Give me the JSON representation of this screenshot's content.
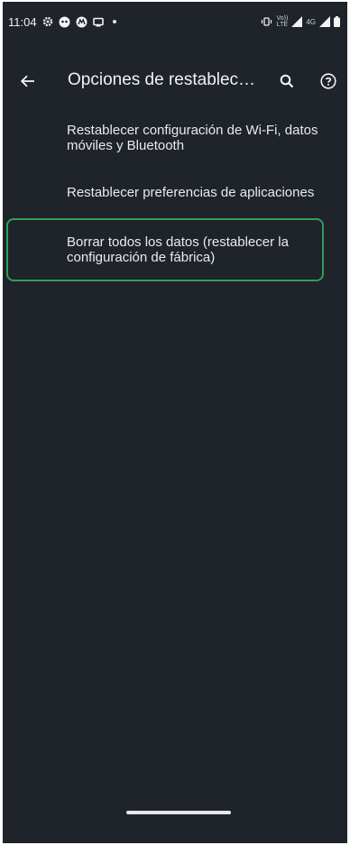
{
  "status_bar": {
    "time": "11:04",
    "left_icons": [
      "gear-icon",
      "face-icon",
      "motorola-icon",
      "screen-cast-icon",
      "notification-dot-icon"
    ],
    "right_icons": [
      "vibrate-icon",
      "volte-icon",
      "signal-icon",
      "4g-icon",
      "battery-icon"
    ],
    "volte_label_top": "Vo))",
    "volte_label_bottom": "LTE",
    "network_label": "4G"
  },
  "toolbar": {
    "title": "Opciones de restablec…",
    "back_icon": "arrow-back-icon",
    "search_icon": "search-icon",
    "help_icon": "help-icon"
  },
  "reset_options": [
    {
      "label": "Restablecer configuración de Wi-Fi, datos móviles y Bluetooth"
    },
    {
      "label": "Restablecer preferencias de aplicaciones"
    },
    {
      "label": "Borrar todos los datos (restablecer la configuración de fábrica)",
      "highlighted": true
    }
  ],
  "colors": {
    "background": "#1f232a",
    "text": "#e9ebee",
    "highlight_border": "#2f9e5a"
  }
}
